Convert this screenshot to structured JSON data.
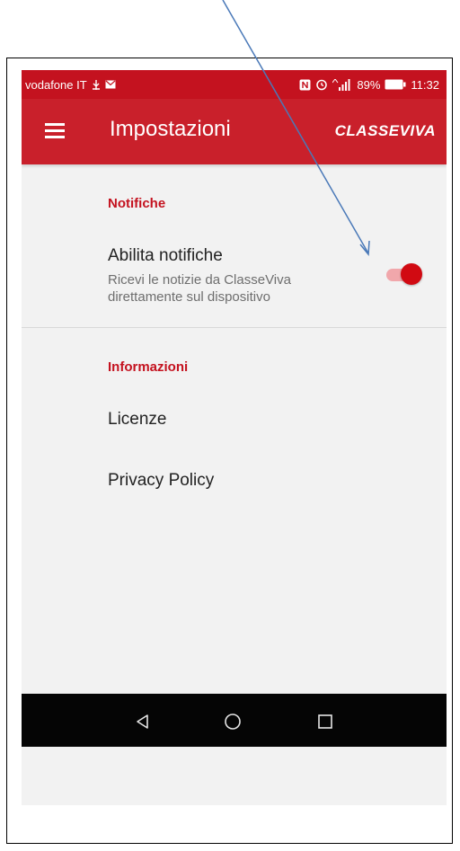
{
  "status_bar": {
    "carrier": "vodafone IT",
    "battery": "89%",
    "time": "11:32"
  },
  "app_bar": {
    "title": "Impostazioni",
    "brand": "CLASSEVIVA"
  },
  "sections": {
    "notifications": {
      "header": "Notifiche",
      "enable_title": "Abilita notifiche",
      "enable_subtitle": "Ricevi le notizie da ClasseViva direttamente sul dispositivo",
      "enabled": true
    },
    "info": {
      "header": "Informazioni",
      "licenses": "Licenze",
      "privacy": "Privacy Policy"
    }
  },
  "colors": {
    "primary": "#c9202b",
    "accent": "#d10a12",
    "annotation_arrow": "#4a79b8"
  },
  "icons": {
    "menu": "hamburger-menu-icon",
    "back": "nav-back-triangle-icon",
    "home": "nav-home-circle-icon",
    "recents": "nav-recents-square-icon"
  }
}
